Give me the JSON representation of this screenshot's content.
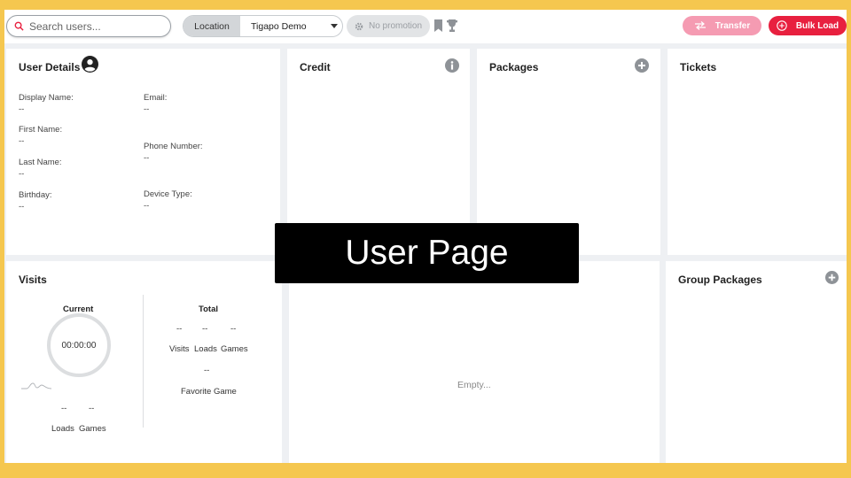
{
  "search": {
    "placeholder": "Search users..."
  },
  "location": {
    "label": "Location",
    "value": "Tigapo Demo"
  },
  "promotion": {
    "label": "No promotion"
  },
  "actions": {
    "transfer": "Transfer",
    "bulk_load": "Bulk Load"
  },
  "user_details": {
    "title": "User Details",
    "display_name": {
      "label": "Display Name:",
      "value": "--"
    },
    "email": {
      "label": "Email:",
      "value": "--"
    },
    "first_name": {
      "label": "First Name:",
      "value": "--"
    },
    "phone_number": {
      "label": "Phone Number:",
      "value": "--"
    },
    "last_name": {
      "label": "Last Name:",
      "value": "--"
    },
    "birthday": {
      "label": "Birthday:",
      "value": "--"
    },
    "device_type": {
      "label": "Device Type:",
      "value": "--"
    }
  },
  "credit": {
    "title": "Credit"
  },
  "packages": {
    "title": "Packages"
  },
  "tickets": {
    "title": "Tickets"
  },
  "visits": {
    "title": "Visits",
    "current_label": "Current",
    "timer": "00:00:00",
    "current_loads": "--",
    "current_games": "--",
    "loads_label": "Loads",
    "games_label": "Games",
    "total_label": "Total",
    "total_visits": "--",
    "total_loads": "--",
    "total_games": "--",
    "visits_label": "Visits",
    "favorite_value": "--",
    "favorite_label": "Favorite Game"
  },
  "middle": {
    "empty_text": "Empty..."
  },
  "group_packages": {
    "title": "Group Packages"
  },
  "overlay": {
    "text": "User Page"
  },
  "colors": {
    "accent": "#e8203f",
    "transfer": "#f59bb2",
    "frame": "#f5c74f"
  }
}
